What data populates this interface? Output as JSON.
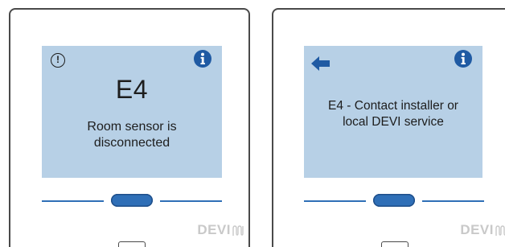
{
  "left_panel": {
    "error_code": "E4",
    "message_line1": "Room sensor is",
    "message_line2": "disconnected",
    "warning_icon": "!",
    "logo": "DEVI"
  },
  "right_panel": {
    "message_line1": "E4 - Contact installer or",
    "message_line2": "local DEVI service",
    "logo": "DEVI"
  },
  "icons": {
    "warning": "warning-circle-icon",
    "info": "info-icon",
    "back": "back-arrow-icon"
  },
  "colors": {
    "screen_bg": "#b7d0e6",
    "accent_blue": "#2f6fb7",
    "logo_gray": "#c9c9c9",
    "frame": "#4a4a4a"
  }
}
